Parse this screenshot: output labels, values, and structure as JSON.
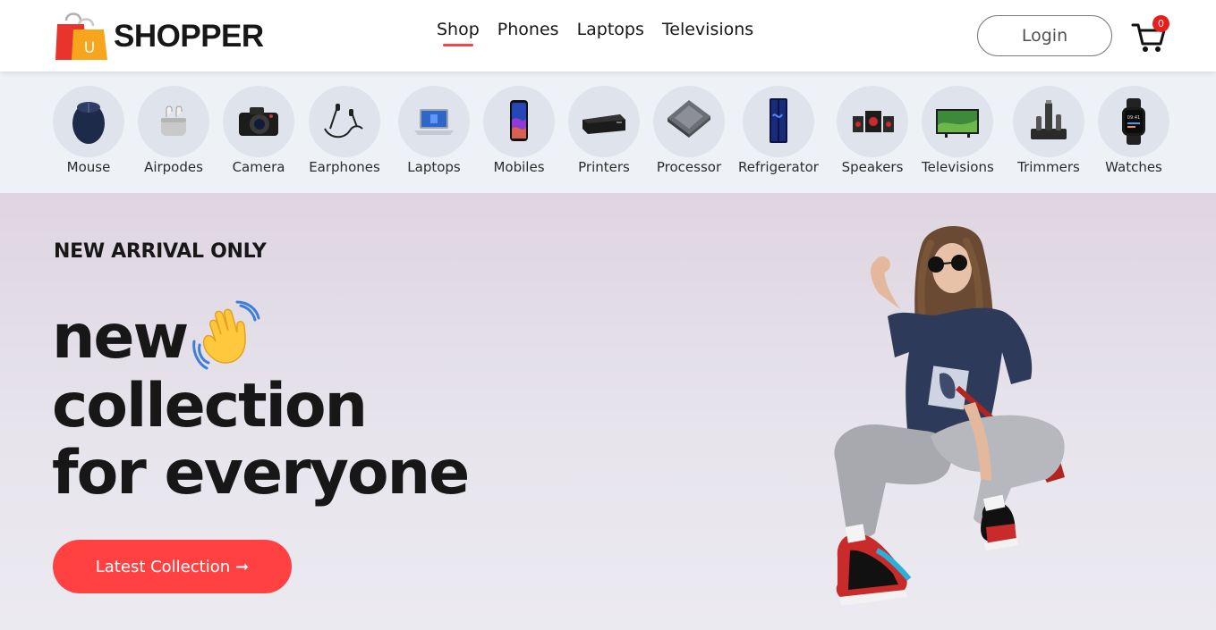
{
  "brand": {
    "name": "SHOPPER",
    "badge_letter": "U"
  },
  "nav": {
    "items": [
      {
        "label": "Shop",
        "active": true
      },
      {
        "label": "Phones",
        "active": false
      },
      {
        "label": "Laptops",
        "active": false
      },
      {
        "label": "Televisions",
        "active": false
      }
    ],
    "login_label": "Login",
    "cart_count": "0"
  },
  "categories": [
    {
      "label": "Mouse",
      "icon": "mouse-icon"
    },
    {
      "label": "Airpodes",
      "icon": "airpods-icon"
    },
    {
      "label": "Camera",
      "icon": "camera-icon"
    },
    {
      "label": "Earphones",
      "icon": "earphones-icon"
    },
    {
      "label": "Laptops",
      "icon": "laptop-icon"
    },
    {
      "label": "Mobiles",
      "icon": "mobile-icon"
    },
    {
      "label": "Printers",
      "icon": "printer-icon"
    },
    {
      "label": "Processor",
      "icon": "processor-icon"
    },
    {
      "label": "Refrigerator",
      "icon": "refrigerator-icon"
    },
    {
      "label": "Speakers",
      "icon": "speaker-icon"
    },
    {
      "label": "Televisions",
      "icon": "television-icon"
    },
    {
      "label": "Trimmers",
      "icon": "trimmer-icon"
    },
    {
      "label": "Watches",
      "icon": "watch-icon"
    }
  ],
  "hero": {
    "kicker": "NEW ARRIVAL ONLY",
    "line1": "new",
    "line2": "collection",
    "line3": "for everyone",
    "cta_label": "Latest Collection",
    "cta_arrow": "➞"
  },
  "colors": {
    "accent": "#ff4141",
    "text": "#171717",
    "strip_bg": "#eef1f6"
  }
}
